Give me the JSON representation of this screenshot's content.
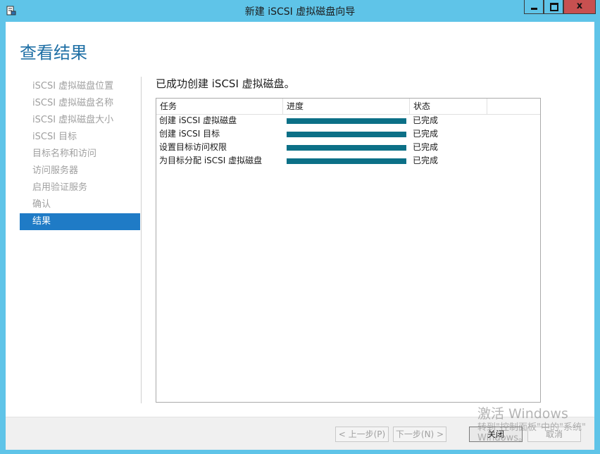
{
  "window": {
    "title": "新建 iSCSI 虚拟磁盘向导",
    "close_glyph": "x",
    "accent_color": "#5fc4e8"
  },
  "page": {
    "title": "查看结果",
    "heading": "已成功创建 iSCSI 虚拟磁盘。"
  },
  "steps": [
    {
      "label": "iSCSI 虚拟磁盘位置",
      "active": false
    },
    {
      "label": "iSCSI 虚拟磁盘名称",
      "active": false
    },
    {
      "label": "iSCSI 虚拟磁盘大小",
      "active": false
    },
    {
      "label": "iSCSI 目标",
      "active": false
    },
    {
      "label": "目标名称和访问",
      "active": false
    },
    {
      "label": "访问服务器",
      "active": false
    },
    {
      "label": "启用验证服务",
      "active": false
    },
    {
      "label": "确认",
      "active": false
    },
    {
      "label": "结果",
      "active": true
    }
  ],
  "table": {
    "columns": [
      "任务",
      "进度",
      "状态"
    ],
    "rows": [
      {
        "task": "创建 iSCSI 虚拟磁盘",
        "progress": 1.0,
        "status": "已完成"
      },
      {
        "task": "创建 iSCSI 目标",
        "progress": 1.0,
        "status": "已完成"
      },
      {
        "task": "设置目标访问权限",
        "progress": 1.0,
        "status": "已完成"
      },
      {
        "task": "为目标分配 iSCSI 虚拟磁盘",
        "progress": 1.0,
        "status": "已完成"
      }
    ],
    "progress_color": "#0c7087"
  },
  "footer": {
    "prev_label": "< 上一步(P)",
    "next_label": "下一步(N) >",
    "close_label": "关闭",
    "cancel_label": "取消"
  },
  "watermark": {
    "line1": "激活 Windows",
    "line2": "转到\"控制面板\"中的\"系统\"",
    "line3": "Windows。"
  }
}
